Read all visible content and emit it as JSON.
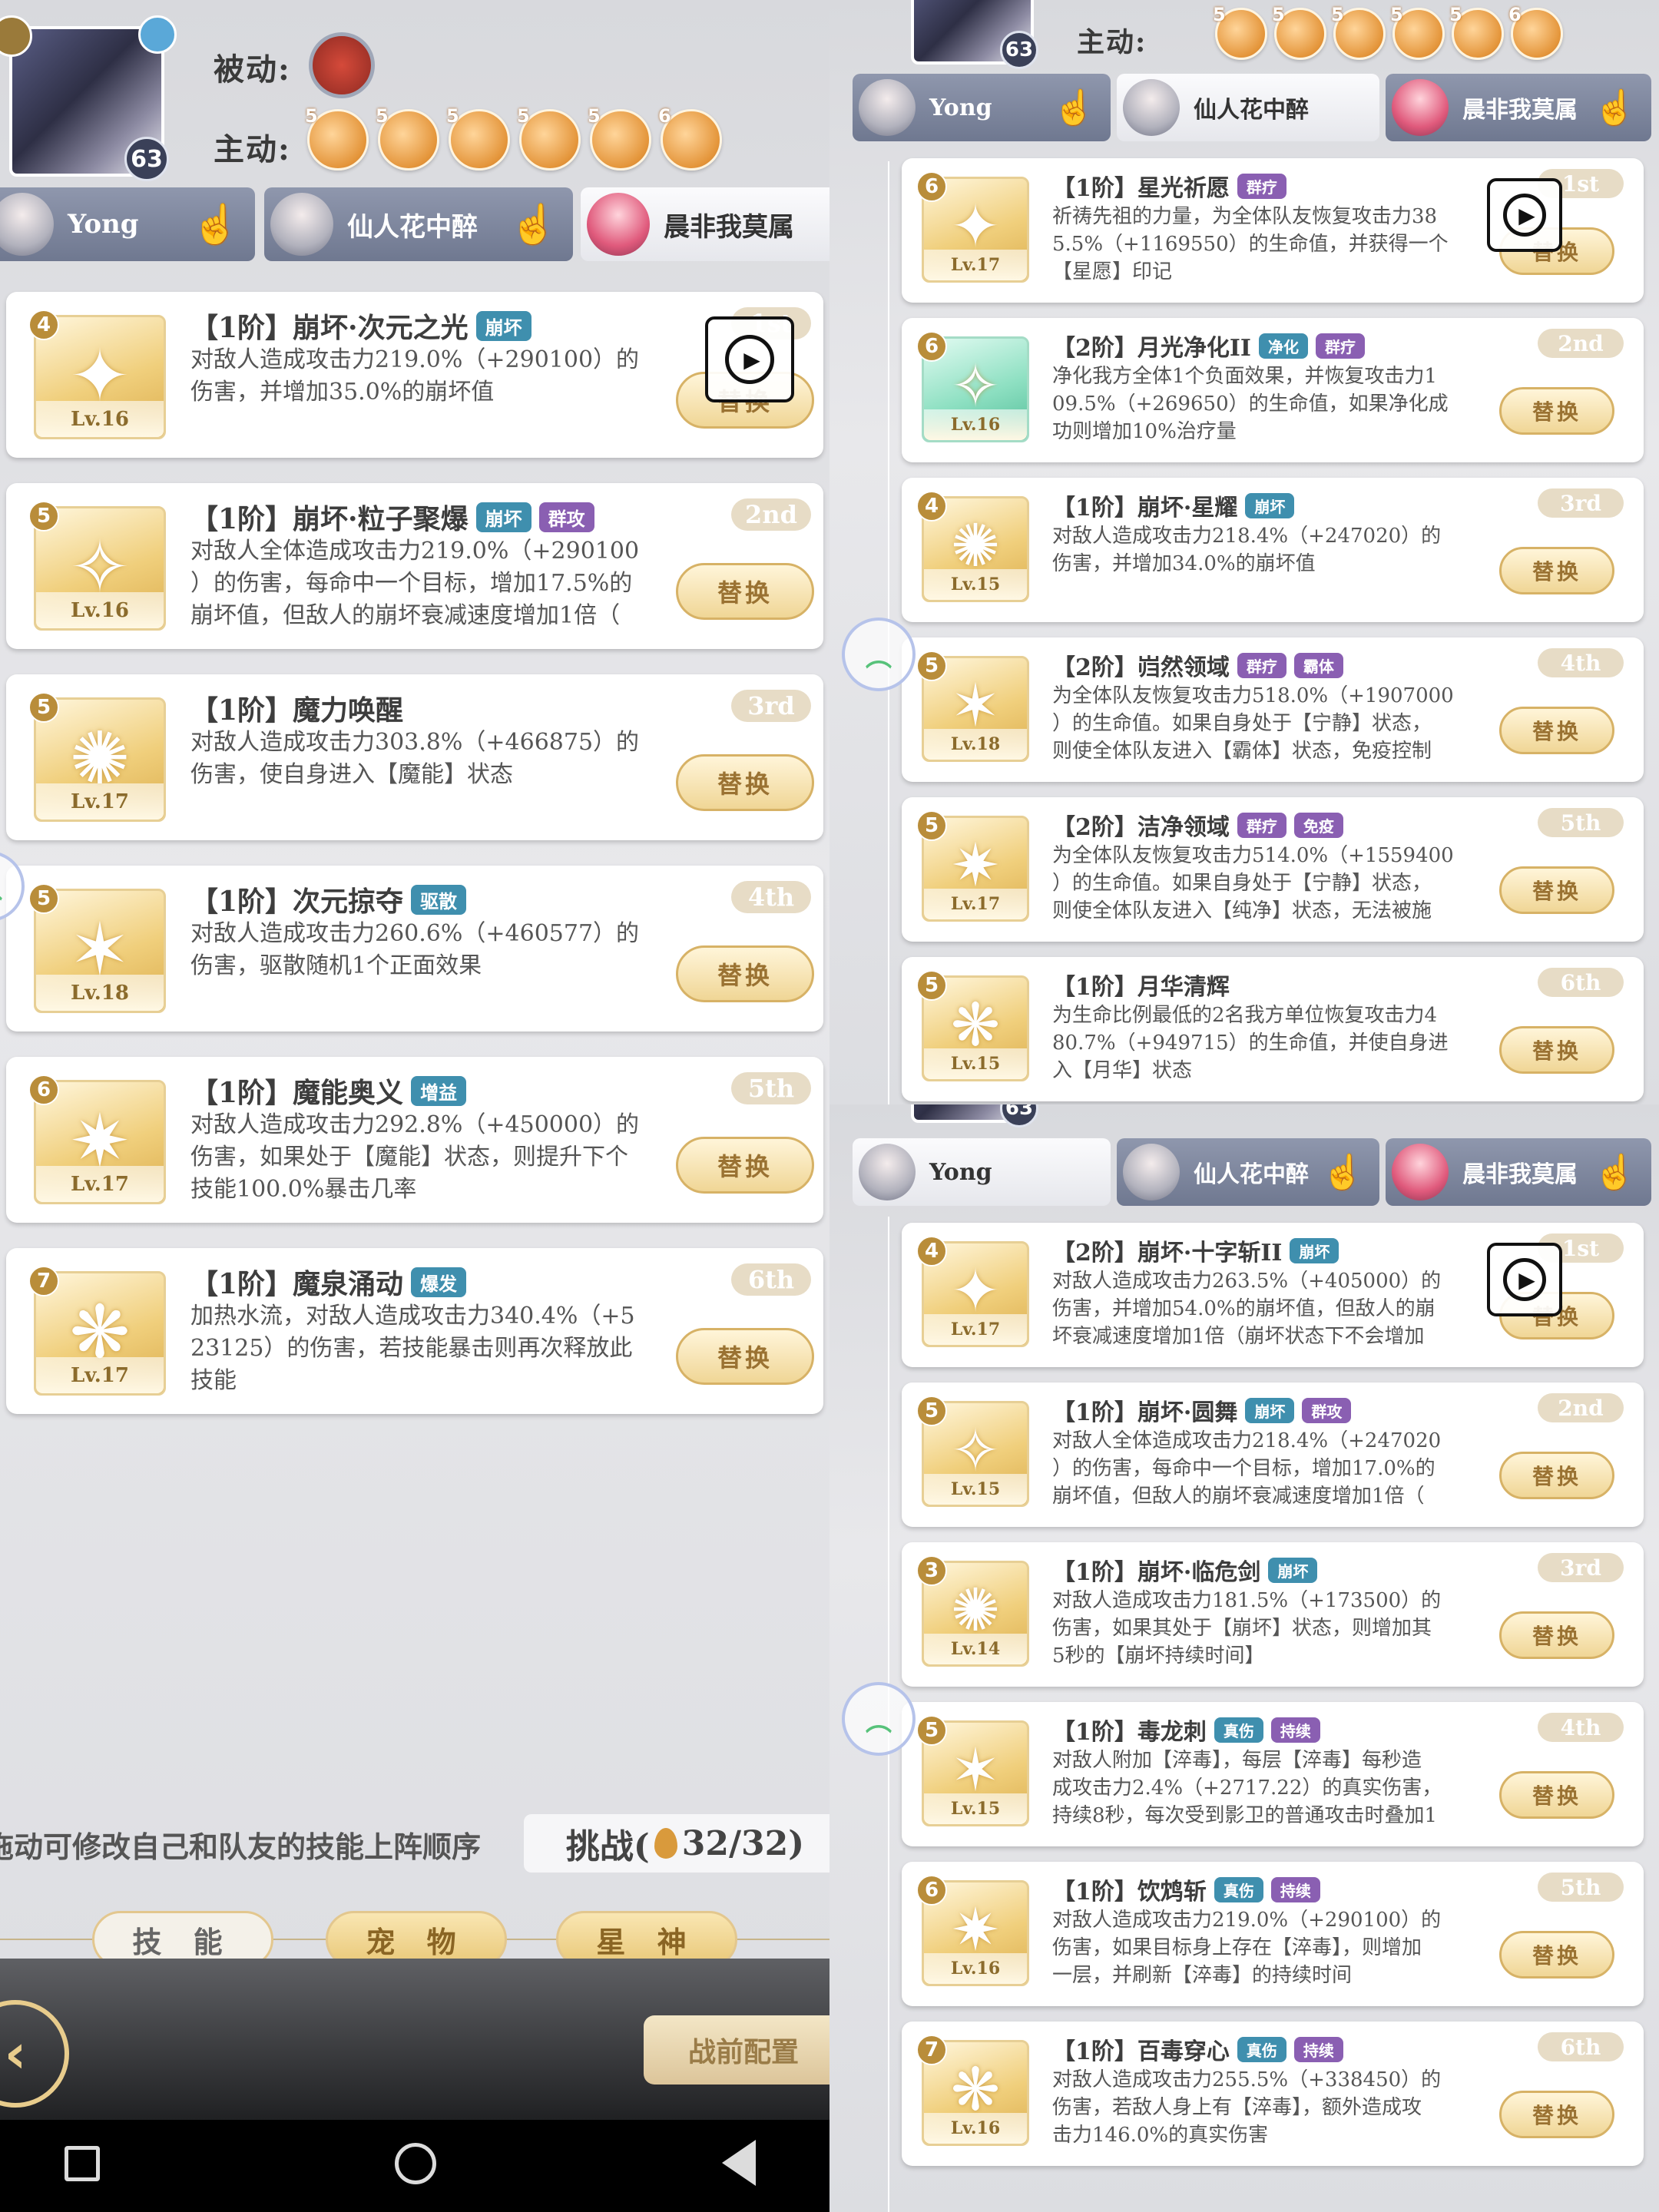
{
  "labels": {
    "passive": "被动:",
    "active": "主动:",
    "level": "63",
    "swap": "替换"
  },
  "active_orbs": [
    "5",
    "5",
    "5",
    "5",
    "5",
    "6"
  ],
  "characters": [
    {
      "name": "Yong"
    },
    {
      "name": "仙人花中醉"
    },
    {
      "name": "晨非我莫属"
    }
  ],
  "panelA": {
    "skills": [
      {
        "star": "4",
        "lv": "Lv.16",
        "name": "【1阶】崩坏·次元之光",
        "tags": [
          "崩坏"
        ],
        "order": "1st",
        "desc": [
          "对敌人造成攻击力219.0%（+290100）的",
          "伤害，并增加35.0%的崩坏值"
        ]
      },
      {
        "star": "5",
        "lv": "Lv.16",
        "name": "【1阶】崩坏·粒子聚爆",
        "tags": [
          "崩坏",
          "群攻"
        ],
        "order": "2nd",
        "desc": [
          "对敌人全体造成攻击力219.0%（+290100",
          "）的伤害，每命中一个目标，增加17.5%的",
          "崩坏值，但敌人的崩坏衰减速度增加1倍（"
        ]
      },
      {
        "star": "5",
        "lv": "Lv.17",
        "name": "【1阶】魔力唤醒",
        "tags": [],
        "order": "3rd",
        "desc": [
          "对敌人造成攻击力303.8%（+466875）的",
          "伤害，使自身进入【魔能】状态"
        ]
      },
      {
        "star": "5",
        "lv": "Lv.18",
        "name": "【1阶】次元掠夺",
        "tags": [
          "驱散"
        ],
        "order": "4th",
        "desc": [
          "对敌人造成攻击力260.6%（+460577）的",
          "伤害，驱散随机1个正面效果"
        ]
      },
      {
        "star": "6",
        "lv": "Lv.17",
        "name": "【1阶】魔能奥义",
        "tags": [
          "增益"
        ],
        "order": "5th",
        "desc": [
          "对敌人造成攻击力292.8%（+450000）的",
          "伤害，如果处于【魔能】状态，则提升下个",
          "技能100.0%暴击几率"
        ]
      },
      {
        "star": "7",
        "lv": "Lv.17",
        "name": "【1阶】魔泉涌动",
        "tags": [
          "爆发"
        ],
        "order": "6th",
        "desc": [
          "加热水流，对敌人造成攻击力340.4%（+5",
          "23125）的伤害，若技能暴击则再次释放此",
          "技能"
        ]
      }
    ],
    "footer": {
      "tip": "拖动可修改自己和队友的技能上阵顺序",
      "challenge": "挑战(",
      "stamina": "32/32)",
      "tabs": [
        "技 能",
        "宠 物",
        "星 神"
      ],
      "prebattle": "战前配置"
    }
  },
  "panelB": {
    "skills": [
      {
        "star": "6",
        "lv": "Lv.17",
        "name": "【1阶】星光祈愿",
        "tags": [
          "群疗"
        ],
        "order": "1st",
        "desc": [
          "祈祷先祖的力量，为全体队友恢复攻击力38",
          "5.5%（+1169550）的生命值，并获得一个",
          "【星愿】印记"
        ]
      },
      {
        "star": "6",
        "lv": "Lv.16",
        "name": "【2阶】月光净化II",
        "tags": [
          "净化",
          "群疗"
        ],
        "order": "2nd",
        "green": true,
        "desc": [
          "净化我方全体1个负面效果，并恢复攻击力1",
          "09.5%（+269650）的生命值，如果净化成",
          "功则增加10%治疗量"
        ]
      },
      {
        "star": "4",
        "lv": "Lv.15",
        "name": "【1阶】崩坏·星耀",
        "tags": [
          "崩坏"
        ],
        "order": "3rd",
        "desc": [
          "对敌人造成攻击力218.4%（+247020）的",
          "伤害，并增加34.0%的崩坏值"
        ]
      },
      {
        "star": "5",
        "lv": "Lv.18",
        "name": "【2阶】岿然领域",
        "tags": [
          "群疗",
          "霸体"
        ],
        "order": "4th",
        "desc": [
          "为全体队友恢复攻击力518.0%（+1907000",
          "）的生命值。如果自身处于【宁静】状态，",
          "则使全体队友进入【霸体】状态，免疫控制"
        ]
      },
      {
        "star": "5",
        "lv": "Lv.17",
        "name": "【2阶】洁净领域",
        "tags": [
          "群疗",
          "免疫"
        ],
        "order": "5th",
        "desc": [
          "为全体队友恢复攻击力514.0%（+1559400",
          "）的生命值。如果自身处于【宁静】状态，",
          "则使全体队友进入【纯净】状态，无法被施"
        ]
      },
      {
        "star": "5",
        "lv": "Lv.15",
        "name": "【1阶】月华清辉",
        "tags": [],
        "order": "6th",
        "desc": [
          "为生命比例最低的2名我方单位恢复攻击力4",
          "80.7%（+949715）的生命值，并使自身进",
          "入【月华】状态"
        ]
      }
    ]
  },
  "panelC": {
    "skills": [
      {
        "star": "4",
        "lv": "Lv.17",
        "name": "【2阶】崩坏·十字斩II",
        "tags": [
          "崩坏"
        ],
        "order": "1st",
        "desc": [
          "对敌人造成攻击力263.5%（+405000）的",
          "伤害，并增加54.0%的崩坏值，但敌人的崩",
          "坏衰减速度增加1倍（崩坏状态下不会增加"
        ]
      },
      {
        "star": "5",
        "lv": "Lv.15",
        "name": "【1阶】崩坏·圆舞",
        "tags": [
          "崩坏",
          "群攻"
        ],
        "order": "2nd",
        "desc": [
          "对敌人全体造成攻击力218.4%（+247020",
          "）的伤害，每命中一个目标，增加17.0%的",
          "崩坏值，但敌人的崩坏衰减速度增加1倍（"
        ]
      },
      {
        "star": "3",
        "lv": "Lv.14",
        "name": "【1阶】崩坏·临危剑",
        "tags": [
          "崩坏"
        ],
        "order": "3rd",
        "desc": [
          "对敌人造成攻击力181.5%（+173500）的",
          "伤害，如果其处于【崩坏】状态，则增加其",
          "5秒的【崩坏持续时间】"
        ]
      },
      {
        "star": "5",
        "lv": "Lv.15",
        "name": "【1阶】毒龙刺",
        "tags": [
          "真伤",
          "持续"
        ],
        "order": "4th",
        "desc": [
          "对敌人附加【淬毒】，每层【淬毒】每秒造",
          "成攻击力2.4%（+2717.22）的真实伤害，",
          "持续8秒，每次受到影卫的普通攻击时叠加1"
        ]
      },
      {
        "star": "6",
        "lv": "Lv.16",
        "name": "【1阶】饮鸩斩",
        "tags": [
          "真伤",
          "持续"
        ],
        "order": "5th",
        "desc": [
          "对敌人造成攻击力219.0%（+290100）的",
          "伤害，如果目标身上存在【淬毒】，则增加",
          "一层，并刷新【淬毒】的持续时间"
        ]
      },
      {
        "star": "7",
        "lv": "Lv.16",
        "name": "【1阶】百毒穿心",
        "tags": [
          "真伤",
          "持续"
        ],
        "order": "6th",
        "desc": [
          "对敌人造成攻击力255.5%（+338450）的",
          "伤害，若敌人身上有【淬毒】，额外造成攻",
          "击力146.0%的真实伤害"
        ]
      }
    ]
  }
}
